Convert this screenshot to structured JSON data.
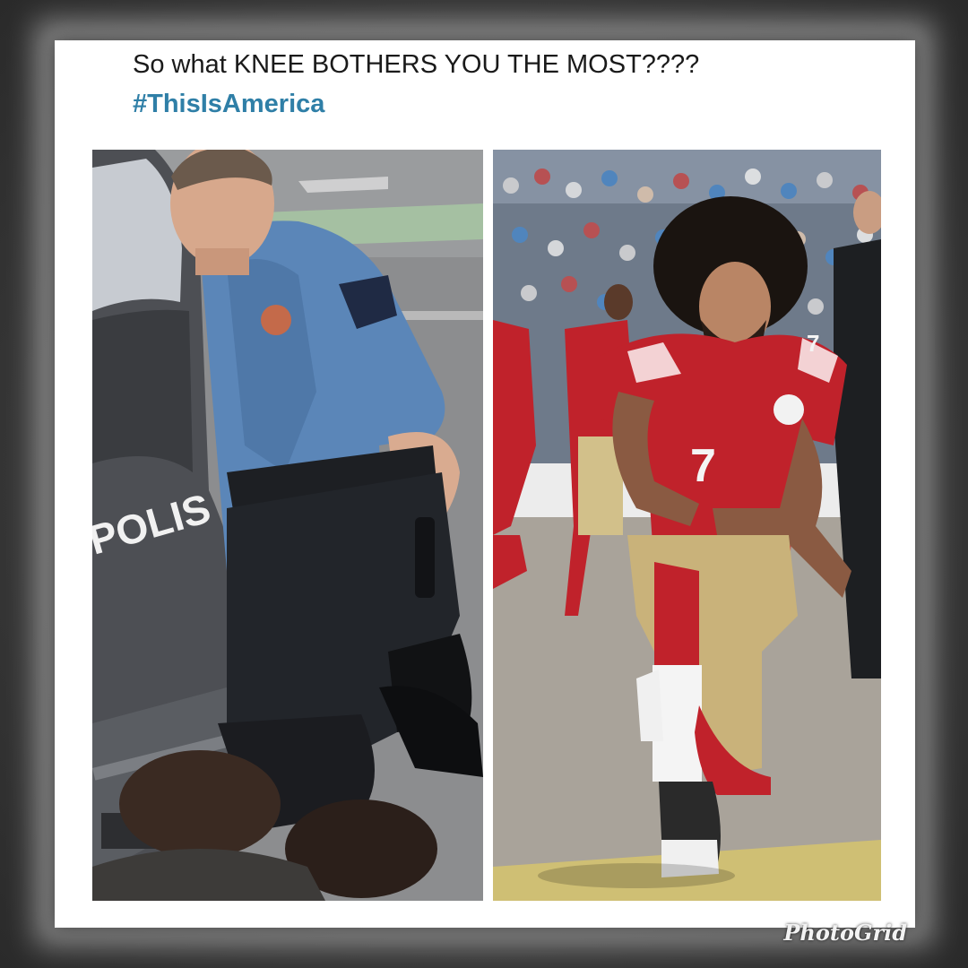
{
  "post": {
    "caption": "So what KNEE BOTHERS YOU THE MOST????",
    "hashtag": "#ThisIsAmerica"
  },
  "photos": {
    "left": {
      "vehicle_text": "POLIS"
    },
    "right": {
      "jersey_number": "7",
      "shoulder_number": "7"
    }
  },
  "watermark": "PhotoGrid",
  "colors": {
    "card": "#ffffff",
    "caption_text": "#1a1a1a",
    "hashtag": "#2f7fa7",
    "police_uniform": "#5b86b8",
    "jersey_red": "#c0222b",
    "pants_gold": "#c9b27a",
    "field": "#a9a39a"
  }
}
